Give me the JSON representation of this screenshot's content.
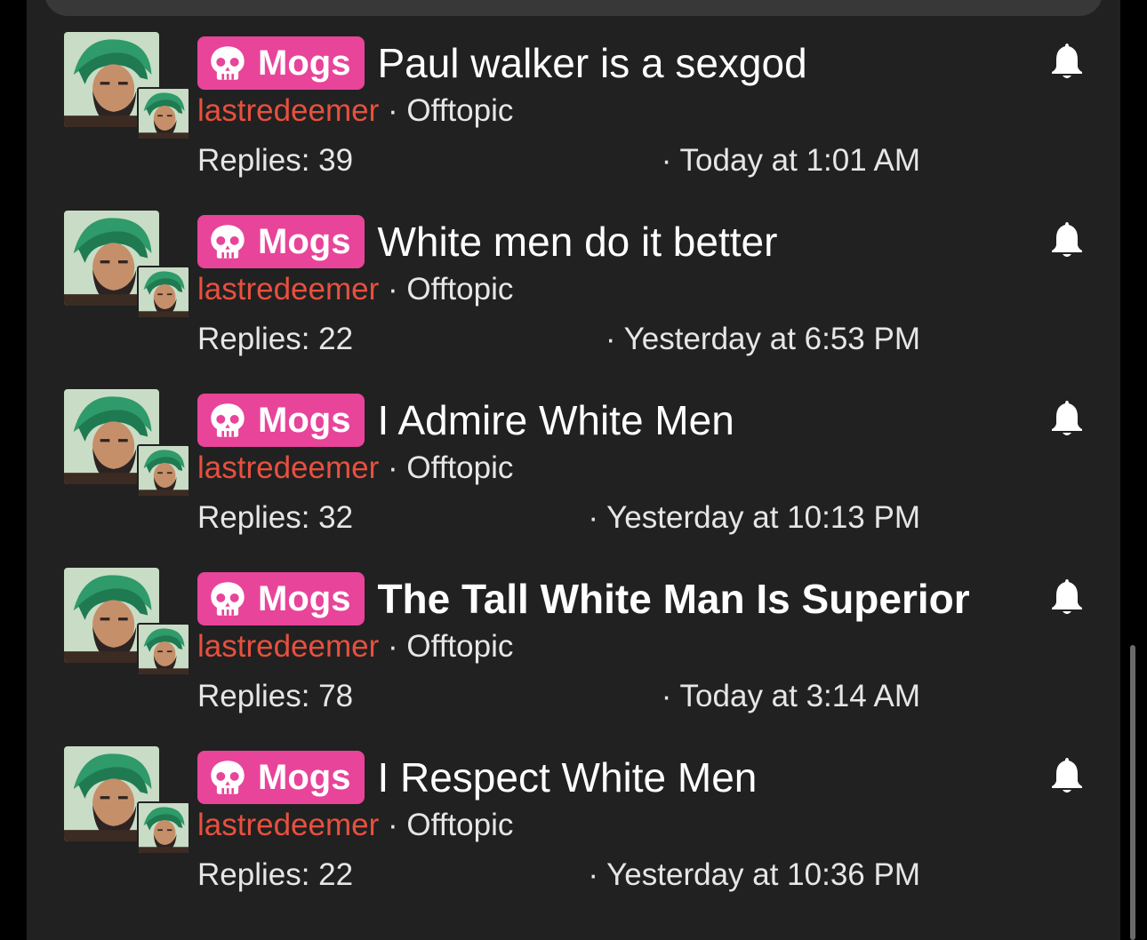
{
  "threads": [
    {
      "prefix": "Mogs",
      "title": "Paul walker is a sexgod",
      "bold": false,
      "author": "lastredeemer",
      "separator": "·",
      "forum": "Offtopic",
      "replies": "Replies: 39",
      "date": "· Today at 1:01 AM"
    },
    {
      "prefix": "Mogs",
      "title": "White men do it better",
      "bold": false,
      "author": "lastredeemer",
      "separator": "·",
      "forum": "Offtopic",
      "replies": "Replies: 22",
      "date": "· Yesterday at 6:53 PM"
    },
    {
      "prefix": "Mogs",
      "title": "I Admire White Men",
      "bold": false,
      "author": "lastredeemer",
      "separator": "·",
      "forum": "Offtopic",
      "replies": "Replies: 32",
      "date": "· Yesterday at 10:13 PM"
    },
    {
      "prefix": "Mogs",
      "title": "The Tall White Man Is Superior",
      "bold": true,
      "author": "lastredeemer",
      "separator": "·",
      "forum": "Offtopic",
      "replies": "Replies: 78",
      "date": "· Today at 3:14 AM"
    },
    {
      "prefix": "Mogs",
      "title": "I Respect White Men",
      "bold": false,
      "author": "lastredeemer",
      "separator": "·",
      "forum": "Offtopic",
      "replies": "Replies: 22",
      "date": "· Yesterday at 10:36 PM"
    }
  ],
  "icons": {
    "prefix_icon": "skull-icon",
    "watch_icon": "bell-icon"
  },
  "colors": {
    "background": "#212121",
    "prefix_bg": "#e8449a",
    "author": "#e8503e",
    "text": "#e6e6e6"
  }
}
